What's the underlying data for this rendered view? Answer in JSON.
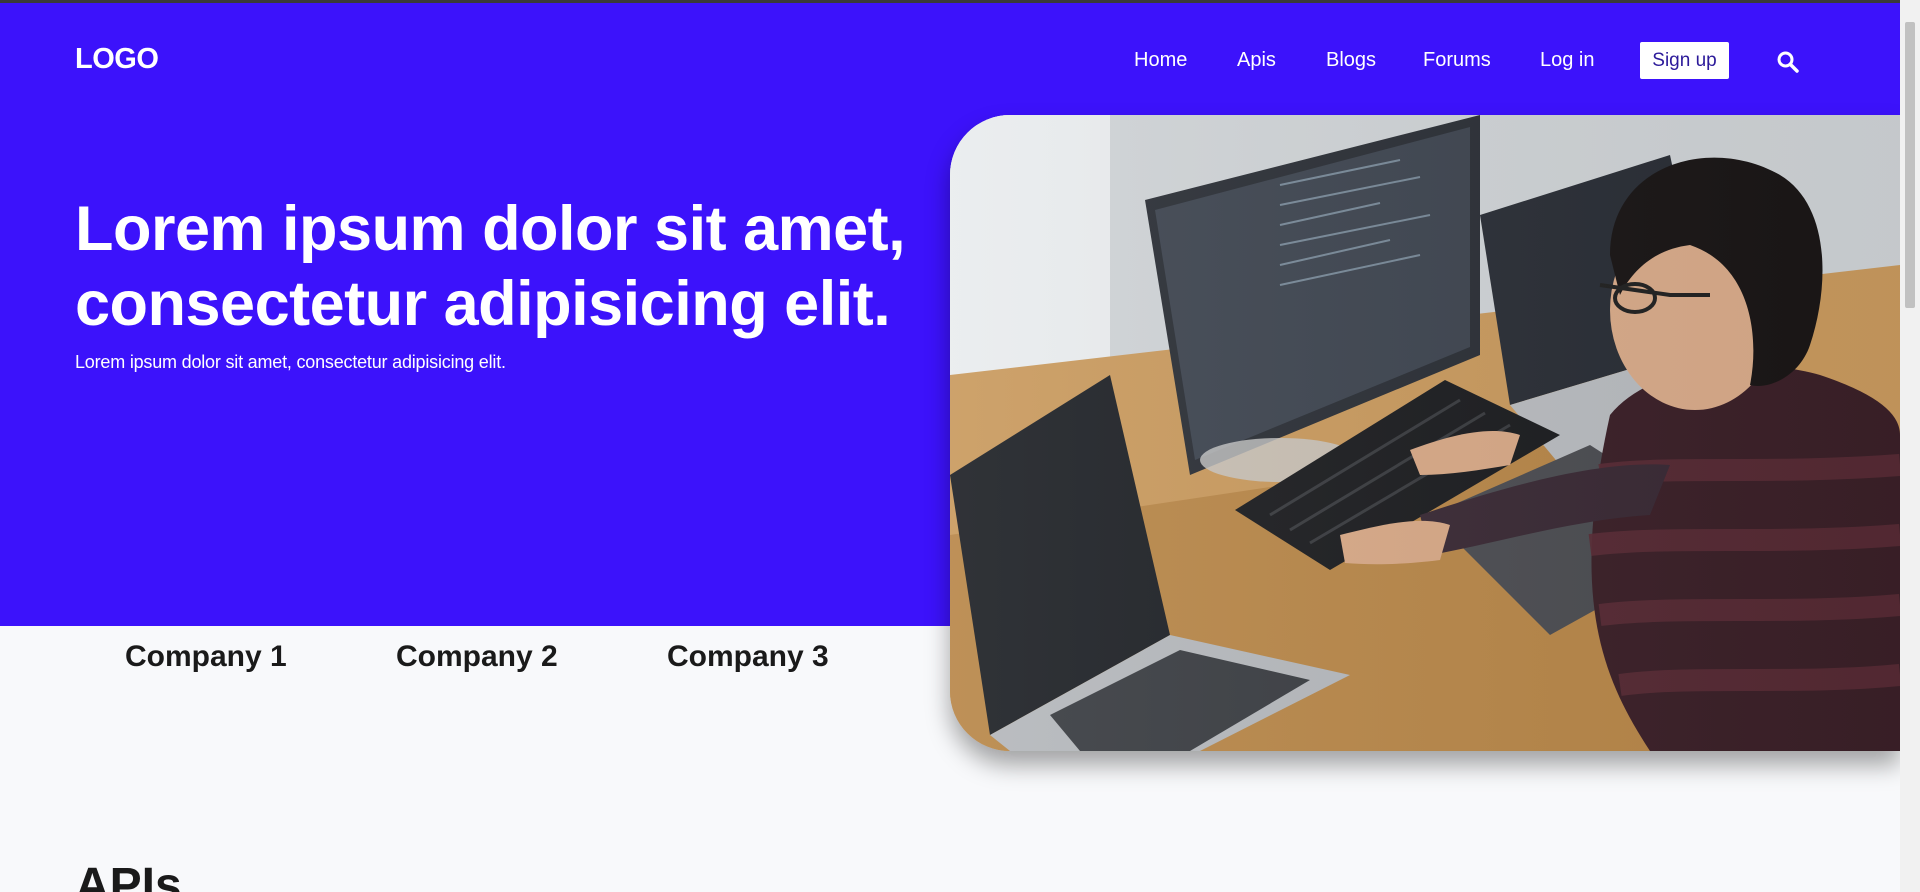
{
  "navbar": {
    "logo": "LOGO",
    "links": [
      "Home",
      "Apis",
      "Blogs",
      "Forums",
      "Log in"
    ],
    "signup_label": "Sign up",
    "search_icon": "search-icon"
  },
  "hero": {
    "title": "Lorem ipsum dolor sit amet, consectetur adipisicing elit.",
    "subtitle": "Lorem ipsum dolor sit amet, consectetur adipisicing elit.",
    "image_icon": "developer-workspace-photo"
  },
  "companies": [
    "Company 1",
    "Company 2",
    "Company 3"
  ],
  "apis_section": {
    "title": "APIs"
  },
  "colors": {
    "hero_background": "#3c12fb",
    "page_background": "#f8f9fb",
    "text_dark": "#1a1a1a",
    "signup_text": "#2c1a9a"
  }
}
